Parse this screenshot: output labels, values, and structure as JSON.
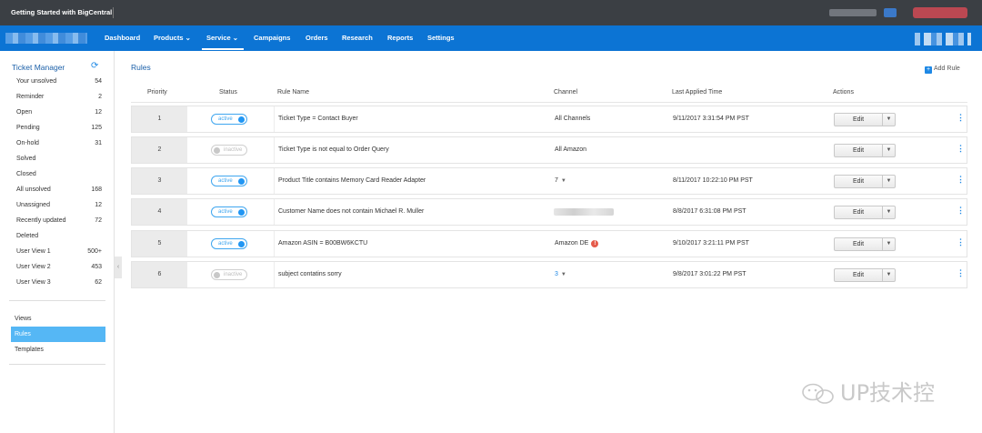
{
  "topbar": {
    "title": "Getting Started with BigCentral"
  },
  "nav": {
    "items": [
      {
        "label": "Dashboard"
      },
      {
        "label": "Products"
      },
      {
        "label": "Service"
      },
      {
        "label": "Campaigns"
      },
      {
        "label": "Orders"
      },
      {
        "label": "Research"
      },
      {
        "label": "Reports"
      },
      {
        "label": "Settings"
      }
    ],
    "active": "Service"
  },
  "sidebar": {
    "title": "Ticket Manager",
    "items": [
      {
        "label": "Your unsolved",
        "count": "54"
      },
      {
        "label": "Reminder",
        "count": "2"
      },
      {
        "label": "Open",
        "count": "12"
      },
      {
        "label": "Pending",
        "count": "125"
      },
      {
        "label": "On-hold",
        "count": "31"
      },
      {
        "label": "Solved",
        "count": ""
      },
      {
        "label": "Closed",
        "count": ""
      },
      {
        "label": "All unsolved",
        "count": "168"
      },
      {
        "label": "Unassigned",
        "count": "12"
      },
      {
        "label": "Recently updated",
        "count": "72"
      },
      {
        "label": "Deleted",
        "count": ""
      },
      {
        "label": "User View 1",
        "count": "500+"
      },
      {
        "label": "User View 2",
        "count": "453"
      },
      {
        "label": "User View 3",
        "count": "62"
      }
    ],
    "links": [
      {
        "label": "Views"
      },
      {
        "label": "Rules"
      },
      {
        "label": "Templates"
      }
    ],
    "active_link": "Rules"
  },
  "main": {
    "title": "Rules",
    "add_rule": "Add Rule",
    "columns": {
      "priority": "Priority",
      "status": "Status",
      "rule_name": "Rule Name",
      "channel": "Channel",
      "last_applied": "Last Applied Time",
      "actions": "Actions"
    },
    "edit_label": "Edit",
    "rows": [
      {
        "priority": "1",
        "status": "active",
        "rule": "Ticket Type = Contact Buyer",
        "channel": "All Channels",
        "time": "9/11/2017 3:31:54 PM PST"
      },
      {
        "priority": "2",
        "status": "inactive",
        "rule": "Ticket Type is not equal to Order Query",
        "channel": "All Amazon",
        "time": ""
      },
      {
        "priority": "3",
        "status": "active",
        "rule": "Product Title contains Memory Card Reader Adapter",
        "channel": "7",
        "time": "8/11/2017 10:22:10 PM PST"
      },
      {
        "priority": "4",
        "status": "active",
        "rule": "Customer Name does not contain Michael R. Muller",
        "channel": "",
        "time": "8/8/2017 6:31:08 PM PST"
      },
      {
        "priority": "5",
        "status": "active",
        "rule": "Amazon ASIN = B00BW6KCTU",
        "channel": "Amazon DE",
        "time": "9/10/2017 3:21:11 PM PST"
      },
      {
        "priority": "6",
        "status": "inactive",
        "rule": "subject contatins sorry",
        "channel": "3",
        "time": "9/8/2017 3:01:22 PM PST"
      }
    ]
  },
  "watermark": "UP技术控",
  "colors": {
    "nav_bg": "#0c74d4",
    "topbar_bg": "#3b3f44",
    "accent": "#1e88e5",
    "active_link_bg": "#55b7f5",
    "warning": "#e55b4b"
  }
}
